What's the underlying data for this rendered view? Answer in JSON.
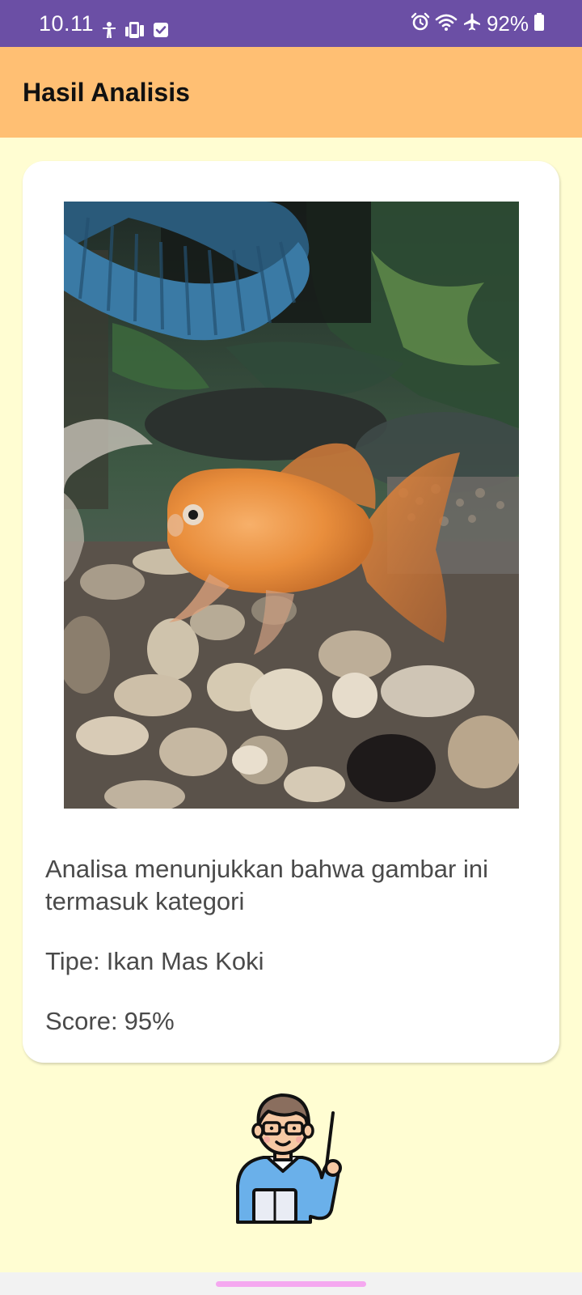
{
  "status_bar": {
    "time": "10.11",
    "battery": "92%",
    "left_icons": [
      "accessibility-icon",
      "device-sync-icon",
      "checkbox-notification-icon"
    ],
    "right_icons": [
      "alarm-icon",
      "wifi-icon",
      "airplane-mode-icon",
      "battery-icon"
    ]
  },
  "app_bar": {
    "title": "Hasil Analisis"
  },
  "result": {
    "image": "goldfish-photo",
    "description": "Analisa menunjukkan bahwa gambar ini termasuk kategori",
    "type_label": "Tipe:",
    "type_value": "Ikan Mas Koki",
    "score_label": "Score:",
    "score_value": "95%"
  },
  "illustration": "teacher-with-pointer-icon",
  "colors": {
    "status_bar": "#6B4FA5",
    "app_bar": "#FFBF73",
    "background": "#FFFDD2",
    "card": "#FFFFFF",
    "gesture_pill": "#F5A8F0"
  }
}
